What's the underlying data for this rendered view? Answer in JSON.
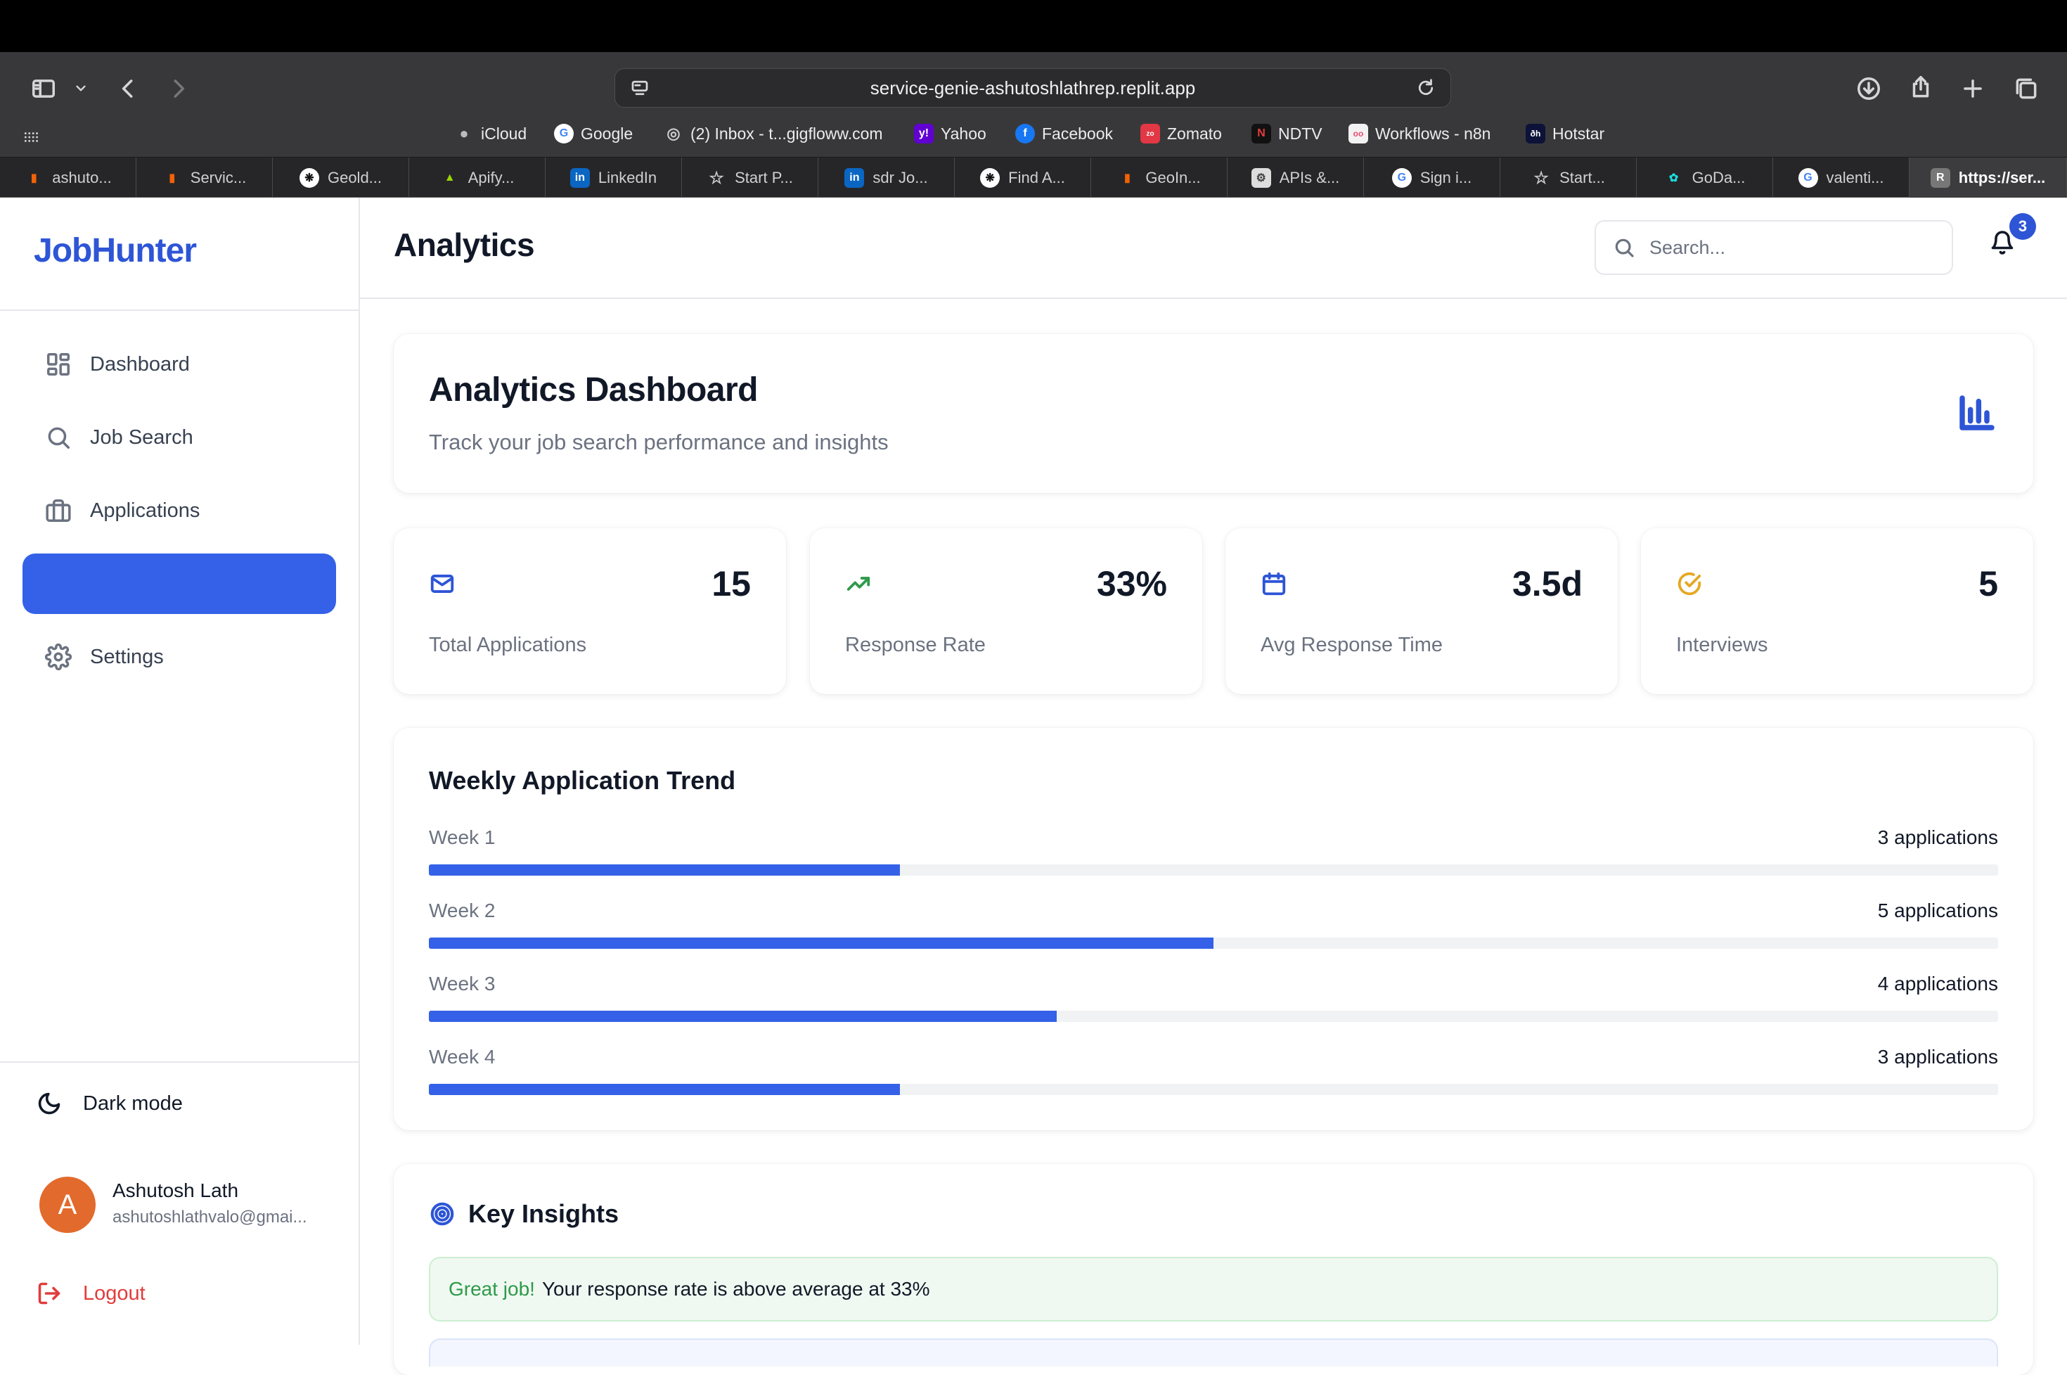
{
  "browser": {
    "url": "service-genie-ashutoshlathrep.replit.app",
    "favorites": [
      {
        "label": "iCloud",
        "icon": "apple-icon"
      },
      {
        "label": "Google",
        "icon": "google-icon"
      },
      {
        "label": "(2) Inbox - t...gigfloww.com",
        "icon": "globe-icon"
      },
      {
        "label": "Yahoo",
        "icon": "yahoo-icon"
      },
      {
        "label": "Facebook",
        "icon": "facebook-icon"
      },
      {
        "label": "Zomato",
        "icon": "zomato-icon"
      },
      {
        "label": "NDTV",
        "icon": "ndtv-icon"
      },
      {
        "label": "Workflows - n8n",
        "icon": "n8n-icon"
      },
      {
        "label": "Hotstar",
        "icon": "hotstar-icon"
      }
    ],
    "tabs": [
      {
        "label": "ashuto..."
      },
      {
        "label": "Servic..."
      },
      {
        "label": "Geold..."
      },
      {
        "label": "Apify..."
      },
      {
        "label": "LinkedIn"
      },
      {
        "label": "Start P..."
      },
      {
        "label": "sdr Jo..."
      },
      {
        "label": "Find A..."
      },
      {
        "label": "GeoIn..."
      },
      {
        "label": "APIs &..."
      },
      {
        "label": "Sign i..."
      },
      {
        "label": "Start..."
      },
      {
        "label": "GoDa..."
      },
      {
        "label": "valenti..."
      },
      {
        "label": "https://ser..."
      }
    ]
  },
  "sidebar": {
    "logo": "JobHunter",
    "nav": [
      {
        "label": "Dashboard",
        "icon": "grid-icon"
      },
      {
        "label": "Job Search",
        "icon": "search-icon"
      },
      {
        "label": "Applications",
        "icon": "briefcase-icon"
      },
      {
        "label": "",
        "icon": ""
      },
      {
        "label": "Settings",
        "icon": "gear-icon"
      }
    ],
    "dark_mode": "Dark mode",
    "user": {
      "initial": "A",
      "name": "Ashutosh Lath",
      "email": "ashutoshlathvalo@gmai..."
    },
    "logout": "Logout"
  },
  "header": {
    "title": "Analytics",
    "search_placeholder": "Search...",
    "notification_count": "3"
  },
  "hero": {
    "title": "Analytics Dashboard",
    "subtitle": "Track your job search performance and insights"
  },
  "stats": [
    {
      "value": "15",
      "label": "Total Applications",
      "icon": "mail-icon",
      "color": "#2d55d6"
    },
    {
      "value": "33%",
      "label": "Response Rate",
      "icon": "trending-up-icon",
      "color": "#2e9a4a"
    },
    {
      "value": "3.5d",
      "label": "Avg Response Time",
      "icon": "calendar-icon",
      "color": "#2d55d6"
    },
    {
      "value": "5",
      "label": "Interviews",
      "icon": "check-circle-icon",
      "color": "#e5a823"
    }
  ],
  "trend": {
    "title": "Weekly Application Trend",
    "max": 10,
    "weeks": [
      {
        "label": "Week 1",
        "count_text": "3 applications",
        "value": 3
      },
      {
        "label": "Week 2",
        "count_text": "5 applications",
        "value": 5
      },
      {
        "label": "Week 3",
        "count_text": "4 applications",
        "value": 4
      },
      {
        "label": "Week 4",
        "count_text": "3 applications",
        "value": 3
      }
    ]
  },
  "insights": {
    "title": "Key Insights",
    "items": [
      {
        "lead": "Great job!",
        "text": "Your response rate is above average at 33%"
      }
    ]
  }
}
